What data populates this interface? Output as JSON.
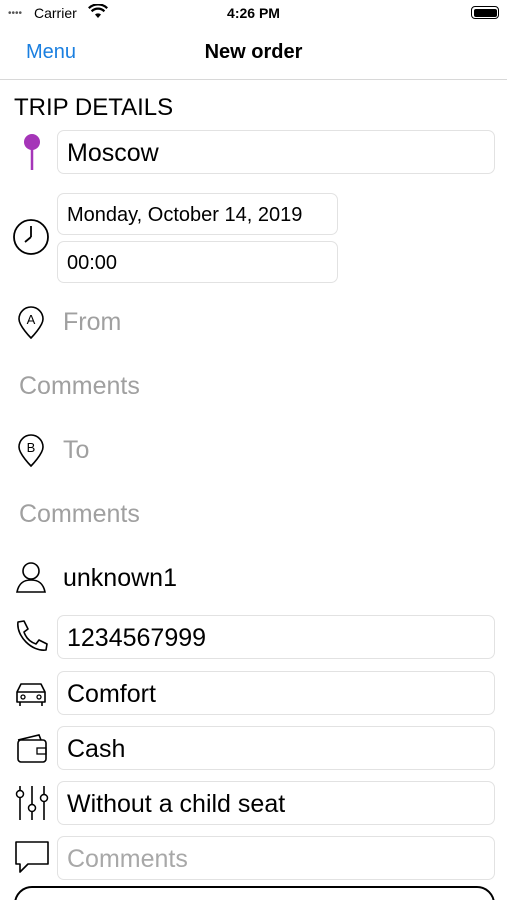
{
  "status_bar": {
    "carrier": "Carrier",
    "time": "4:26 PM"
  },
  "nav": {
    "menu_label": "Menu",
    "title": "New order"
  },
  "section_title": "TRIP DETAILS",
  "city": {
    "value": "Moscow",
    "pin_color": "#a535b8"
  },
  "date": {
    "value": "Monday, October 14, 2019"
  },
  "time": {
    "value": "00:00"
  },
  "from": {
    "placeholder": "From",
    "comments_placeholder": "Comments"
  },
  "to": {
    "placeholder": "To",
    "comments_placeholder": "Comments"
  },
  "contact": {
    "name": "unknown1",
    "phone": "1234567999"
  },
  "car_class": {
    "value": "Comfort"
  },
  "payment": {
    "value": "Cash"
  },
  "options": {
    "value": "Without a child seat"
  },
  "order_comment": {
    "placeholder": "Comments"
  },
  "colors": {
    "accent": "#1a7fe0",
    "placeholder": "#a8a8a8",
    "border": "#e2e2e2"
  }
}
